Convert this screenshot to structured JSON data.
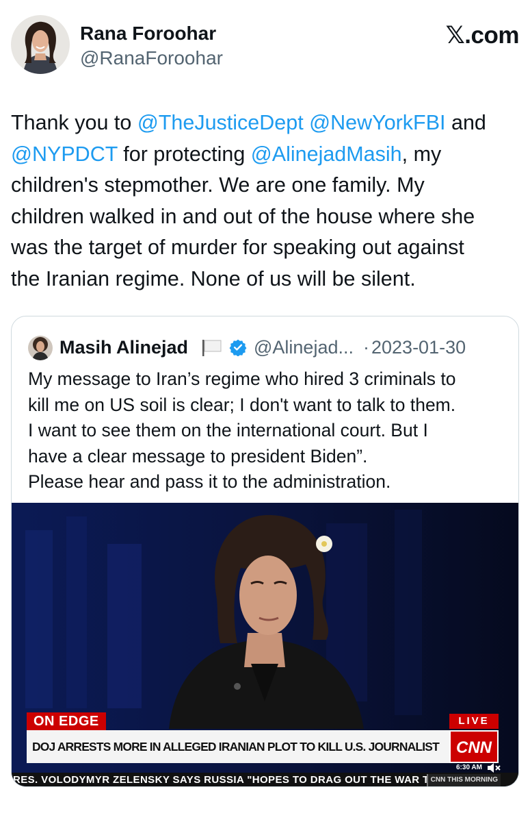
{
  "author": {
    "name": "Rana Foroohar",
    "handle": "@RanaForoohar"
  },
  "site_label": "𝕏.com",
  "tweet": {
    "lines": [
      [
        {
          "t": "Thank you to "
        },
        {
          "t": "@TheJusticeDept",
          "m": true
        },
        {
          "t": " "
        },
        {
          "t": "@NewYorkFBI",
          "m": true
        },
        {
          "t": " and"
        }
      ],
      [
        {
          "t": "@NYPDCT",
          "m": true
        },
        {
          "t": " for protecting "
        },
        {
          "t": "@AlinejadMasih",
          "m": true
        },
        {
          "t": ", my"
        }
      ],
      [
        {
          "t": "children's stepmother. We are one family. My"
        }
      ],
      [
        {
          "t": "children walked in and out of the house where she"
        }
      ],
      [
        {
          "t": "was the target of murder for speaking out against"
        }
      ],
      [
        {
          "t": "the Iranian regime. None of us will be silent."
        }
      ]
    ]
  },
  "quote": {
    "name": "Masih Alinejad",
    "handle": "@Alinejad...",
    "separator": "·",
    "date": "2023-01-30",
    "lines": [
      "My message to Iran’s regime who hired 3 criminals to",
      "kill me on US soil is clear; I don't want to talk to them.",
      "I want to see them on the international court. But I",
      "have a clear message to president Biden”.",
      "Please hear and pass it to the administration."
    ],
    "video": {
      "banner_top": "ON EDGE",
      "headline": "DOJ ARRESTS MORE IN ALLEGED IRANIAN PLOT TO KILL U.S. JOURNALIST",
      "live_label": "LIVE",
      "network": "CNN",
      "time": "6:30 AM",
      "ticker": "RES. VOLODYMYR ZELENSKY SAYS RUSSIA \"HOPES TO DRAG OUT THE WAR T",
      "ticker_brand": "CNN THIS MORNING"
    }
  },
  "colors": {
    "mention": "#1d9bf0",
    "secondary_text": "#536471",
    "verified": "#1d9bf0",
    "cnn_red": "#cc0000",
    "card_border": "#cfd9de"
  },
  "icons": {
    "verified": "verified-badge-icon",
    "flag": "white-flag-icon",
    "mute": "mute-icon"
  }
}
